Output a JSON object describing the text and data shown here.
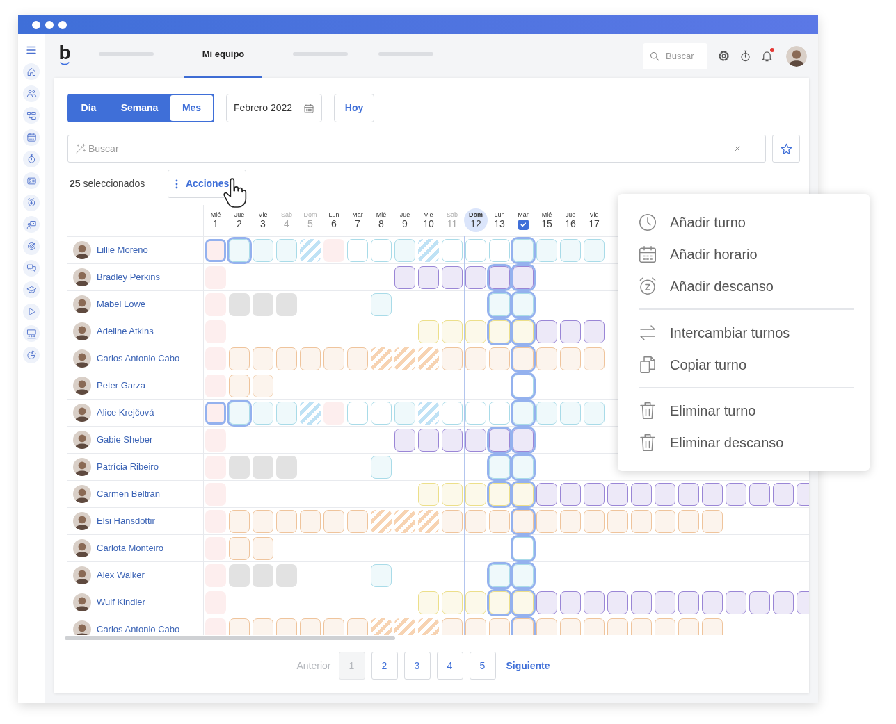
{
  "logo": {
    "text": "b"
  },
  "nav": {
    "tabs": [
      {
        "kind": "placeholder",
        "selected": false
      },
      {
        "kind": "label",
        "label": "Mi equipo",
        "selected": true
      },
      {
        "kind": "placeholder",
        "selected": false
      },
      {
        "kind": "placeholder",
        "selected": false
      }
    ]
  },
  "topbar": {
    "search": {
      "placeholder": "Buscar"
    },
    "unread_notifications": true
  },
  "view_switch": [
    {
      "label": "Día",
      "selected": false
    },
    {
      "label": "Semana",
      "selected": false
    },
    {
      "label": "Mes",
      "selected": true
    }
  ],
  "date_picker": {
    "value": "Febrero 2022"
  },
  "today_button": "Hoy",
  "search": {
    "placeholder": "Buscar"
  },
  "selection": {
    "text": "**25** seleccionados"
  },
  "actions_button": "Acciones",
  "calendar": {
    "days": [
      {
        "weekday": "Mié",
        "day": "1",
        "weekend": false,
        "today": false
      },
      {
        "weekday": "Jue",
        "day": "2",
        "weekend": false,
        "today": false
      },
      {
        "weekday": "Vie",
        "day": "3",
        "weekend": false,
        "today": false
      },
      {
        "weekday": "Sab",
        "day": "4",
        "weekend": true,
        "today": false
      },
      {
        "weekday": "Dom",
        "day": "5",
        "weekend": true,
        "today": false
      },
      {
        "weekday": "Lun",
        "day": "6",
        "weekend": false,
        "today": false
      },
      {
        "weekday": "Mar",
        "day": "7",
        "weekend": false,
        "today": false
      },
      {
        "weekday": "Mié",
        "day": "8",
        "weekend": false,
        "today": false
      },
      {
        "weekday": "Jue",
        "day": "9",
        "weekend": false,
        "today": false
      },
      {
        "weekday": "Vie",
        "day": "10",
        "weekend": false,
        "today": false
      },
      {
        "weekday": "Sab",
        "day": "11",
        "weekend": true,
        "today": false
      },
      {
        "weekday": "Dom",
        "day": "12",
        "weekend": false,
        "today": true
      },
      {
        "weekday": "Lun",
        "day": "13",
        "weekend": false,
        "today": false
      },
      {
        "weekday": "Mar",
        "kind": "checkbox",
        "checked": true,
        "weekend": false,
        "today": false
      },
      {
        "weekday": "Mié",
        "day": "15",
        "weekend": false,
        "today": false
      },
      {
        "weekday": "Jue",
        "day": "16",
        "weekend": false,
        "today": false
      },
      {
        "weekday": "Vie",
        "day": "17",
        "weekend": false,
        "today": false
      }
    ],
    "rows": [
      {
        "name": "Lillie Moreno",
        "cells": [
          {
            "kind": "absence",
            "selected": true
          },
          {
            "kind": "shift",
            "color": "#a9dbe8",
            "selected": true
          },
          {
            "kind": "shift",
            "color": "#a9dbe8",
            "selected": false
          },
          {
            "kind": "shift",
            "color": "#a9dbe8",
            "selected": false
          },
          {
            "kind": "striped",
            "color": "#bfe2f5",
            "selected": false
          },
          {
            "kind": "absence",
            "selected": false
          },
          {
            "kind": "open",
            "color": "#a9dbe8",
            "selected": false
          },
          {
            "kind": "open",
            "color": "#a9dbe8",
            "selected": false
          },
          {
            "kind": "shift",
            "color": "#a9dbe8",
            "selected": false
          },
          {
            "kind": "striped",
            "color": "#bfe2f5",
            "selected": false
          },
          {
            "kind": "open",
            "color": "#a9dbe8",
            "selected": false
          },
          {
            "kind": "open",
            "color": "#a9dbe8",
            "selected": false
          },
          {
            "kind": "open",
            "color": "#a9dbe8",
            "selected": false
          },
          {
            "kind": "shift",
            "color": "#a9dbe8",
            "selected": true
          },
          {
            "kind": "shift",
            "color": "#a9dbe8",
            "selected": false
          },
          {
            "kind": "shift",
            "color": "#a9dbe8",
            "selected": false
          },
          {
            "kind": "shift",
            "color": "#a9dbe8",
            "selected": false
          }
        ]
      },
      {
        "name": "Bradley Perkins",
        "cells": [
          {
            "kind": "absence",
            "selected": false
          },
          {
            "kind": "empty"
          },
          {
            "kind": "empty"
          },
          {
            "kind": "empty"
          },
          {
            "kind": "empty"
          },
          {
            "kind": "empty"
          },
          {
            "kind": "empty"
          },
          {
            "kind": "empty"
          },
          {
            "kind": "shift",
            "color": "#9a86d6",
            "selected": false
          },
          {
            "kind": "shift",
            "color": "#9a86d6",
            "selected": false
          },
          {
            "kind": "shift",
            "color": "#9a86d6",
            "selected": false
          },
          {
            "kind": "shift",
            "color": "#9a86d6",
            "selected": false
          },
          {
            "kind": "shift",
            "color": "#9a86d6",
            "selected": true
          },
          {
            "kind": "shift",
            "color": "#9a86d6",
            "selected": true
          }
        ]
      },
      {
        "name": "Mabel Lowe",
        "cells": [
          {
            "kind": "absence",
            "selected": false
          },
          {
            "kind": "blocked",
            "selected": false
          },
          {
            "kind": "blocked",
            "selected": false
          },
          {
            "kind": "blocked",
            "selected": false
          },
          {
            "kind": "empty"
          },
          {
            "kind": "empty"
          },
          {
            "kind": "empty"
          },
          {
            "kind": "shift",
            "color": "#a9dbe8",
            "selected": false
          },
          {
            "kind": "empty"
          },
          {
            "kind": "empty"
          },
          {
            "kind": "empty"
          },
          {
            "kind": "empty"
          },
          {
            "kind": "shift",
            "color": "#a9dbe8",
            "selected": true
          },
          {
            "kind": "shift",
            "color": "#a9dbe8",
            "selected": true
          }
        ]
      },
      {
        "name": "Adeline Atkins",
        "cells": [
          {
            "kind": "absence",
            "selected": false
          },
          {
            "kind": "empty"
          },
          {
            "kind": "empty"
          },
          {
            "kind": "empty"
          },
          {
            "kind": "empty"
          },
          {
            "kind": "empty"
          },
          {
            "kind": "empty"
          },
          {
            "kind": "empty"
          },
          {
            "kind": "empty"
          },
          {
            "kind": "shift",
            "color": "#ecdf8a",
            "selected": false
          },
          {
            "kind": "shift",
            "color": "#ecdf8a",
            "selected": false
          },
          {
            "kind": "shift",
            "color": "#ecdf8a",
            "selected": false
          },
          {
            "kind": "shift",
            "color": "#ecdf8a",
            "selected": true
          },
          {
            "kind": "shift",
            "color": "#ecdf8a",
            "selected": true
          },
          {
            "kind": "shift",
            "color": "#9a86d6",
            "selected": false
          },
          {
            "kind": "shift",
            "color": "#9a86d6",
            "selected": false
          },
          {
            "kind": "shift",
            "color": "#9a86d6",
            "selected": false
          }
        ]
      },
      {
        "name": "Carlos Antonio Cabo",
        "cells": [
          {
            "kind": "absence",
            "selected": false
          },
          {
            "kind": "shift",
            "color": "#efc49c",
            "selected": false
          },
          {
            "kind": "shift",
            "color": "#efc49c",
            "selected": false
          },
          {
            "kind": "shift",
            "color": "#efc49c",
            "selected": false
          },
          {
            "kind": "shift",
            "color": "#efc49c",
            "selected": false
          },
          {
            "kind": "shift",
            "color": "#efc49c",
            "selected": false
          },
          {
            "kind": "shift",
            "color": "#efc49c",
            "selected": false
          },
          {
            "kind": "striped",
            "color": "#f7d3b2",
            "selected": false
          },
          {
            "kind": "striped",
            "color": "#f7d3b2",
            "selected": false
          },
          {
            "kind": "striped",
            "color": "#f7d3b2",
            "selected": false
          },
          {
            "kind": "shift",
            "color": "#efc49c",
            "selected": false
          },
          {
            "kind": "shift",
            "color": "#efc49c",
            "selected": false
          },
          {
            "kind": "shift",
            "color": "#efc49c",
            "selected": false
          },
          {
            "kind": "shift",
            "color": "#efc49c",
            "selected": true
          },
          {
            "kind": "shift",
            "color": "#efc49c",
            "selected": false
          },
          {
            "kind": "shift",
            "color": "#efc49c",
            "selected": false
          },
          {
            "kind": "shift",
            "color": "#efc49c",
            "selected": false
          }
        ]
      },
      {
        "name": "Peter Garza",
        "cells": [
          {
            "kind": "absence",
            "selected": false
          },
          {
            "kind": "shift",
            "color": "#efc49c",
            "selected": false
          },
          {
            "kind": "shift",
            "color": "#efc49c",
            "selected": false
          },
          {
            "kind": "empty"
          },
          {
            "kind": "empty"
          },
          {
            "kind": "empty"
          },
          {
            "kind": "empty"
          },
          {
            "kind": "empty"
          },
          {
            "kind": "empty"
          },
          {
            "kind": "empty"
          },
          {
            "kind": "empty"
          },
          {
            "kind": "empty"
          },
          {
            "kind": "empty"
          },
          {
            "kind": "open",
            "color": "#a9dbe8",
            "selected": true
          }
        ]
      },
      {
        "name": "Alice Krejčová",
        "cells": [
          {
            "kind": "absence",
            "selected": true
          },
          {
            "kind": "shift",
            "color": "#a9dbe8",
            "selected": true
          },
          {
            "kind": "shift",
            "color": "#a9dbe8",
            "selected": false
          },
          {
            "kind": "shift",
            "color": "#a9dbe8",
            "selected": false
          },
          {
            "kind": "striped",
            "color": "#bfe2f5",
            "selected": false
          },
          {
            "kind": "absence",
            "selected": false
          },
          {
            "kind": "open",
            "color": "#a9dbe8",
            "selected": false
          },
          {
            "kind": "open",
            "color": "#a9dbe8",
            "selected": false
          },
          {
            "kind": "shift",
            "color": "#a9dbe8",
            "selected": false
          },
          {
            "kind": "striped",
            "color": "#bfe2f5",
            "selected": false
          },
          {
            "kind": "open",
            "color": "#a9dbe8",
            "selected": false
          },
          {
            "kind": "open",
            "color": "#a9dbe8",
            "selected": false
          },
          {
            "kind": "open",
            "color": "#a9dbe8",
            "selected": false
          },
          {
            "kind": "shift",
            "color": "#a9dbe8",
            "selected": true
          },
          {
            "kind": "shift",
            "color": "#a9dbe8",
            "selected": false
          },
          {
            "kind": "shift",
            "color": "#a9dbe8",
            "selected": false
          },
          {
            "kind": "shift",
            "color": "#a9dbe8",
            "selected": false
          }
        ]
      },
      {
        "name": "Gabie Sheber",
        "cells": [
          {
            "kind": "absence",
            "selected": false
          },
          {
            "kind": "empty"
          },
          {
            "kind": "empty"
          },
          {
            "kind": "empty"
          },
          {
            "kind": "empty"
          },
          {
            "kind": "empty"
          },
          {
            "kind": "empty"
          },
          {
            "kind": "empty"
          },
          {
            "kind": "shift",
            "color": "#9a86d6",
            "selected": false
          },
          {
            "kind": "shift",
            "color": "#9a86d6",
            "selected": false
          },
          {
            "kind": "shift",
            "color": "#9a86d6",
            "selected": false
          },
          {
            "kind": "shift",
            "color": "#9a86d6",
            "selected": false
          },
          {
            "kind": "shift",
            "color": "#9a86d6",
            "selected": true
          },
          {
            "kind": "shift",
            "color": "#9a86d6",
            "selected": true
          }
        ]
      },
      {
        "name": "Patrícia Ribeiro",
        "cells": [
          {
            "kind": "absence",
            "selected": false
          },
          {
            "kind": "blocked",
            "selected": false
          },
          {
            "kind": "blocked",
            "selected": false
          },
          {
            "kind": "blocked",
            "selected": false
          },
          {
            "kind": "empty"
          },
          {
            "kind": "empty"
          },
          {
            "kind": "empty"
          },
          {
            "kind": "shift",
            "color": "#a9dbe8",
            "selected": false
          },
          {
            "kind": "empty"
          },
          {
            "kind": "empty"
          },
          {
            "kind": "empty"
          },
          {
            "kind": "empty"
          },
          {
            "kind": "shift",
            "color": "#a9dbe8",
            "selected": true
          },
          {
            "kind": "shift",
            "color": "#a9dbe8",
            "selected": true
          }
        ]
      },
      {
        "name": "Carmen Beltrán",
        "cells": [
          {
            "kind": "absence",
            "selected": false
          },
          {
            "kind": "empty"
          },
          {
            "kind": "empty"
          },
          {
            "kind": "empty"
          },
          {
            "kind": "empty"
          },
          {
            "kind": "empty"
          },
          {
            "kind": "empty"
          },
          {
            "kind": "empty"
          },
          {
            "kind": "empty"
          },
          {
            "kind": "shift",
            "color": "#ecdf8a",
            "selected": false
          },
          {
            "kind": "shift",
            "color": "#ecdf8a",
            "selected": false
          },
          {
            "kind": "shift",
            "color": "#ecdf8a",
            "selected": false
          },
          {
            "kind": "shift",
            "color": "#ecdf8a",
            "selected": true
          },
          {
            "kind": "shift",
            "color": "#ecdf8a",
            "selected": true
          },
          {
            "kind": "shift",
            "color": "#9a86d6",
            "selected": false
          },
          {
            "kind": "shift",
            "color": "#9a86d6",
            "selected": false
          },
          {
            "kind": "shift",
            "color": "#9a86d6",
            "selected": false
          },
          {
            "kind": "shift",
            "color": "#9a86d6",
            "selected": false
          },
          {
            "kind": "shift",
            "color": "#9a86d6",
            "selected": false
          },
          {
            "kind": "shift",
            "color": "#9a86d6",
            "selected": false
          },
          {
            "kind": "shift",
            "color": "#9a86d6",
            "selected": false
          },
          {
            "kind": "shift",
            "color": "#9a86d6",
            "selected": false
          },
          {
            "kind": "shift",
            "color": "#9a86d6",
            "selected": false
          },
          {
            "kind": "shift",
            "color": "#9a86d6",
            "selected": false
          },
          {
            "kind": "shift",
            "color": "#9a86d6",
            "selected": false
          },
          {
            "kind": "shift",
            "color": "#9a86d6",
            "selected": false
          }
        ]
      },
      {
        "name": "Elsi Hansdottir",
        "cells": [
          {
            "kind": "absence",
            "selected": false
          },
          {
            "kind": "shift",
            "color": "#efc49c",
            "selected": false
          },
          {
            "kind": "shift",
            "color": "#efc49c",
            "selected": false
          },
          {
            "kind": "shift",
            "color": "#efc49c",
            "selected": false
          },
          {
            "kind": "shift",
            "color": "#efc49c",
            "selected": false
          },
          {
            "kind": "shift",
            "color": "#efc49c",
            "selected": false
          },
          {
            "kind": "shift",
            "color": "#efc49c",
            "selected": false
          },
          {
            "kind": "striped",
            "color": "#f7d3b2",
            "selected": false
          },
          {
            "kind": "striped",
            "color": "#f7d3b2",
            "selected": false
          },
          {
            "kind": "striped",
            "color": "#f7d3b2",
            "selected": false
          },
          {
            "kind": "shift",
            "color": "#efc49c",
            "selected": false
          },
          {
            "kind": "shift",
            "color": "#efc49c",
            "selected": false
          },
          {
            "kind": "shift",
            "color": "#efc49c",
            "selected": false
          },
          {
            "kind": "shift",
            "color": "#efc49c",
            "selected": true
          },
          {
            "kind": "shift",
            "color": "#efc49c",
            "selected": false
          },
          {
            "kind": "shift",
            "color": "#efc49c",
            "selected": false
          },
          {
            "kind": "shift",
            "color": "#efc49c",
            "selected": false
          },
          {
            "kind": "shift",
            "color": "#efc49c",
            "selected": false
          },
          {
            "kind": "shift",
            "color": "#efc49c",
            "selected": false
          },
          {
            "kind": "shift",
            "color": "#efc49c",
            "selected": false
          },
          {
            "kind": "shift",
            "color": "#efc49c",
            "selected": false
          },
          {
            "kind": "shift",
            "color": "#efc49c",
            "selected": false
          }
        ]
      },
      {
        "name": "Carlota Monteiro",
        "cells": [
          {
            "kind": "absence",
            "selected": false
          },
          {
            "kind": "shift",
            "color": "#efc49c",
            "selected": false
          },
          {
            "kind": "shift",
            "color": "#efc49c",
            "selected": false
          },
          {
            "kind": "empty"
          },
          {
            "kind": "empty"
          },
          {
            "kind": "empty"
          },
          {
            "kind": "empty"
          },
          {
            "kind": "empty"
          },
          {
            "kind": "empty"
          },
          {
            "kind": "empty"
          },
          {
            "kind": "empty"
          },
          {
            "kind": "empty"
          },
          {
            "kind": "empty"
          },
          {
            "kind": "open",
            "color": "#a9dbe8",
            "selected": true
          }
        ]
      },
      {
        "name": "Alex Walker",
        "cells": [
          {
            "kind": "absence",
            "selected": false
          },
          {
            "kind": "blocked",
            "selected": false
          },
          {
            "kind": "blocked",
            "selected": false
          },
          {
            "kind": "blocked",
            "selected": false
          },
          {
            "kind": "empty"
          },
          {
            "kind": "empty"
          },
          {
            "kind": "empty"
          },
          {
            "kind": "shift",
            "color": "#a9dbe8",
            "selected": false
          },
          {
            "kind": "empty"
          },
          {
            "kind": "empty"
          },
          {
            "kind": "empty"
          },
          {
            "kind": "empty"
          },
          {
            "kind": "shift",
            "color": "#a9dbe8",
            "selected": true
          },
          {
            "kind": "shift",
            "color": "#a9dbe8",
            "selected": true
          }
        ]
      },
      {
        "name": "Wulf Kindler",
        "cells": [
          {
            "kind": "absence",
            "selected": false
          },
          {
            "kind": "empty"
          },
          {
            "kind": "empty"
          },
          {
            "kind": "empty"
          },
          {
            "kind": "empty"
          },
          {
            "kind": "empty"
          },
          {
            "kind": "empty"
          },
          {
            "kind": "empty"
          },
          {
            "kind": "empty"
          },
          {
            "kind": "shift",
            "color": "#ecdf8a",
            "selected": false
          },
          {
            "kind": "shift",
            "color": "#ecdf8a",
            "selected": false
          },
          {
            "kind": "shift",
            "color": "#ecdf8a",
            "selected": false
          },
          {
            "kind": "shift",
            "color": "#ecdf8a",
            "selected": true
          },
          {
            "kind": "shift",
            "color": "#ecdf8a",
            "selected": true
          },
          {
            "kind": "shift",
            "color": "#9a86d6",
            "selected": false
          },
          {
            "kind": "shift",
            "color": "#9a86d6",
            "selected": false
          },
          {
            "kind": "shift",
            "color": "#9a86d6",
            "selected": false
          },
          {
            "kind": "shift",
            "color": "#9a86d6",
            "selected": false
          },
          {
            "kind": "shift",
            "color": "#9a86d6",
            "selected": false
          },
          {
            "kind": "shift",
            "color": "#9a86d6",
            "selected": false
          },
          {
            "kind": "shift",
            "color": "#9a86d6",
            "selected": false
          },
          {
            "kind": "shift",
            "color": "#9a86d6",
            "selected": false
          },
          {
            "kind": "shift",
            "color": "#9a86d6",
            "selected": false
          },
          {
            "kind": "shift",
            "color": "#9a86d6",
            "selected": false
          },
          {
            "kind": "shift",
            "color": "#9a86d6",
            "selected": false
          },
          {
            "kind": "shift",
            "color": "#9a86d6",
            "selected": false
          }
        ]
      },
      {
        "name": "Carlos Antonio Cabo",
        "cells": [
          {
            "kind": "absence",
            "selected": false
          },
          {
            "kind": "shift",
            "color": "#efc49c",
            "selected": false
          },
          {
            "kind": "shift",
            "color": "#efc49c",
            "selected": false
          },
          {
            "kind": "shift",
            "color": "#efc49c",
            "selected": false
          },
          {
            "kind": "shift",
            "color": "#efc49c",
            "selected": false
          },
          {
            "kind": "shift",
            "color": "#efc49c",
            "selected": false
          },
          {
            "kind": "shift",
            "color": "#efc49c",
            "selected": false
          },
          {
            "kind": "striped",
            "color": "#f7d3b2",
            "selected": false
          },
          {
            "kind": "striped",
            "color": "#f7d3b2",
            "selected": false
          },
          {
            "kind": "striped",
            "color": "#f7d3b2",
            "selected": false
          },
          {
            "kind": "shift",
            "color": "#efc49c",
            "selected": false
          },
          {
            "kind": "shift",
            "color": "#efc49c",
            "selected": false
          },
          {
            "kind": "shift",
            "color": "#efc49c",
            "selected": false
          },
          {
            "kind": "shift",
            "color": "#efc49c",
            "selected": true
          },
          {
            "kind": "shift",
            "color": "#efc49c",
            "selected": false
          },
          {
            "kind": "shift",
            "color": "#efc49c",
            "selected": false
          },
          {
            "kind": "shift",
            "color": "#efc49c",
            "selected": false
          },
          {
            "kind": "shift",
            "color": "#efc49c",
            "selected": false
          },
          {
            "kind": "shift",
            "color": "#efc49c",
            "selected": false
          },
          {
            "kind": "shift",
            "color": "#efc49c",
            "selected": false
          },
          {
            "kind": "shift",
            "color": "#efc49c",
            "selected": false
          },
          {
            "kind": "shift",
            "color": "#efc49c",
            "selected": false
          }
        ]
      }
    ]
  },
  "pagination": {
    "previous": "Anterior",
    "pages": [
      {
        "label": "1",
        "selected": true
      },
      {
        "label": "2",
        "selected": false
      },
      {
        "label": "3",
        "selected": false
      },
      {
        "label": "4",
        "selected": false
      },
      {
        "label": "5",
        "selected": false
      }
    ],
    "next": "Siguiente"
  },
  "context_menu": {
    "groups": [
      [
        {
          "label": "Añadir turno"
        },
        {
          "label": "Añadir horario"
        },
        {
          "label": "Añadir descanso"
        }
      ],
      [
        {
          "label": "Intercambiar turnos"
        },
        {
          "label": "Copiar turno"
        }
      ],
      [
        {
          "label": "Eliminar turno"
        },
        {
          "label": "Eliminar descanso"
        }
      ]
    ]
  }
}
